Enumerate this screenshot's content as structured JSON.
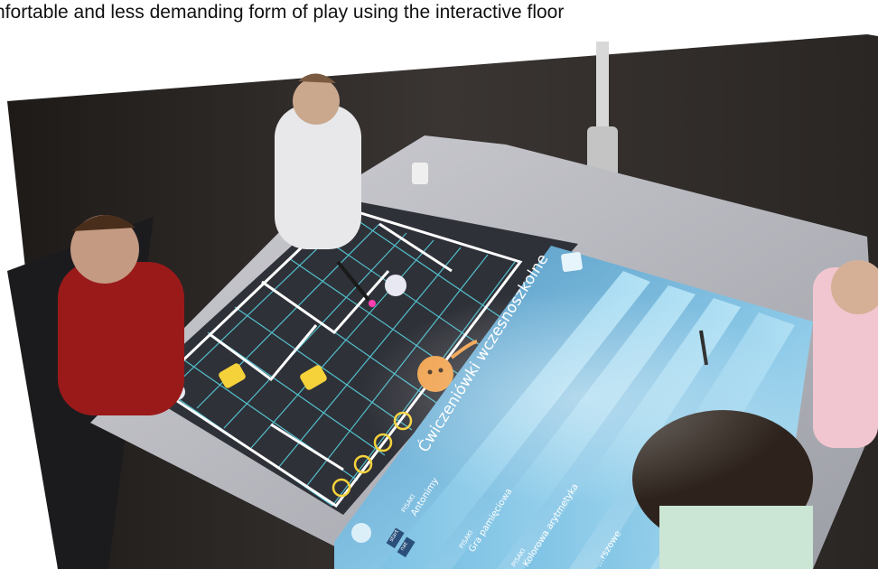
{
  "caption": "nfortable and less demanding form of play using the interactive floor",
  "app": {
    "title": "Ćwiczeniówki wczesnoszkolne",
    "close_icon": "close-icon",
    "games": [
      {
        "category": "PISAKI",
        "name": "Antonimy",
        "badges": [
          "start",
          "nat"
        ]
      },
      {
        "category": "PISAKI",
        "name": "Gra pamięciowa"
      },
      {
        "category": "PISAKI",
        "name": "Kolorowa arytmetyka"
      },
      {
        "category": "",
        "name": "...rszowe"
      }
    ],
    "controls": [
      "close-icon",
      "settings-icon",
      "info-icon",
      "minus-icon"
    ],
    "home_icon": "home-icon"
  },
  "colors": {
    "ui_panel": "#8fd0ec",
    "ui_panel_dark": "#5aa6cf",
    "grid_line": "#ffffff",
    "grid_cell_line": "#59d8e6",
    "accent_yellow": "#f5d23a",
    "cat_orange": "#f0a04a"
  }
}
